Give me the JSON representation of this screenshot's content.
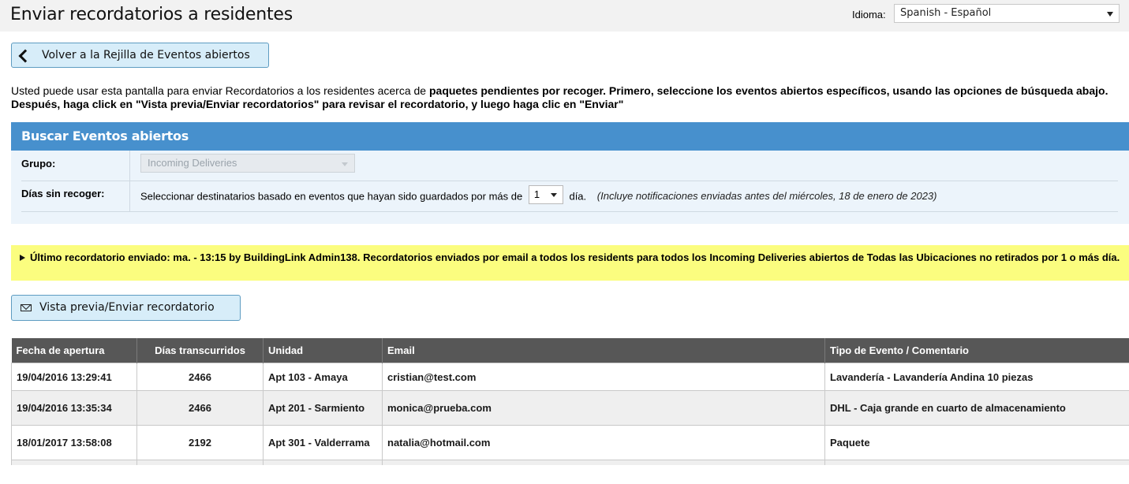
{
  "header": {
    "title": "Enviar recordatorios a residentes",
    "language_label": "Idioma:",
    "language_value": "Spanish - Español"
  },
  "back_button": {
    "label": "Volver a la Rejilla de Eventos abiertos",
    "icon": "chevron-left-icon"
  },
  "intro": {
    "normal": "Usted puede usar esta pantalla para enviar Recordatorios a los residentes acerca de ",
    "bold": "paquetes pendientes por recoger. Primero, seleccione los eventos abiertos específicos, usando las opciones de búsqueda abajo. Después, haga click en \"Vista previa/Enviar recordatorios\" para revisar el recordatorio, y luego haga clic en \"Enviar\""
  },
  "search_panel": {
    "title": "Buscar Eventos abiertos",
    "group_label": "Grupo:",
    "group_value": "Incoming Deliveries",
    "days_label": "Días sin recoger:",
    "days_text_before": "Seleccionar destinatarios basado en eventos que hayan sido guardados por más de",
    "days_value": "1",
    "days_text_after": "día.",
    "days_note": "(Incluye notificaciones enviadas antes del miércoles, 18 de enero de 2023)"
  },
  "last_reminder": {
    "text": "Último recordatorio enviado: ma. - 13:15 by BuildingLink Admin138. Recordatorios enviados por email a todos los residents para todos los Incoming Deliveries abiertos de Todas las Ubicaciones no retirados por 1 o más día."
  },
  "send_button": {
    "label": "Vista previa/Enviar recordatorio",
    "icon": "envelope-icon"
  },
  "table": {
    "columns": [
      "Fecha de apertura",
      "Días transcurridos",
      "Unidad",
      "Email",
      "Tipo de Evento / Comentario"
    ],
    "rows": [
      [
        "19/04/2016 13:29:41",
        "2466",
        "Apt 103 - Amaya",
        "cristian@test.com",
        "Lavandería - Lavandería Andina 10 piezas"
      ],
      [
        "19/04/2016 13:35:34",
        "2466",
        "Apt 201 - Sarmiento",
        "monica@prueba.com",
        "DHL - Caja grande en cuarto de almacenamiento"
      ],
      [
        "18/01/2017 13:58:08",
        "2192",
        "Apt 301 - Valderrama",
        "natalia@hotmail.com",
        "Paquete"
      ]
    ]
  },
  "colors": {
    "header_bg": "#f2f2f2",
    "panel_head": "#4790cd",
    "panel_bg": "#ecf4fb",
    "alert_bg": "#fbfd7f",
    "button_bg": "#d7edf9",
    "table_head": "#575757"
  }
}
